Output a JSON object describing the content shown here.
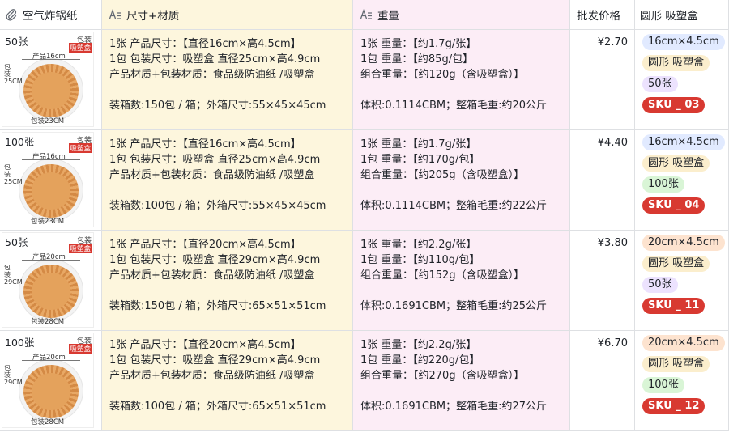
{
  "headers": {
    "col1": "空气炸锅纸",
    "col2": "尺寸+材质",
    "col3": "重量",
    "col4": "批发价格",
    "col5": "圆形 吸塑盒"
  },
  "rows": [
    {
      "image": {
        "qty": "50张",
        "pack": "包装",
        "pack_red": "吸塑盒",
        "size": "产品16cm",
        "vertical": "包装25CM",
        "bottom": "包装23CM"
      },
      "size_lines": [
        "1张 产品尺寸：【直径16cm×高4.5cm】",
        "1包 包装尺寸：吸塑盒 直径25cm×高4.9cm",
        "产品材质+包装材质：食品级防油纸 /吸塑盒",
        "装箱数:150包 / 箱；外箱尺寸:55×45×45cm"
      ],
      "weight_lines": [
        "1张 重量：【约1.7g/张】",
        "1包 重量：【约85g/包】",
        "组合重量：【约120g（含吸塑盒）】",
        "体积:0.1114CBM；整箱毛重:约20公斤"
      ],
      "price": "¥2.70",
      "tags": [
        "16cm×4.5cm",
        "圆形 吸塑盒",
        "50张",
        "SKU _ 03"
      ]
    },
    {
      "image": {
        "qty": "100张",
        "pack": "包装",
        "pack_red": "吸塑盒",
        "size": "产品16cm",
        "vertical": "包装25CM",
        "bottom": "包装23CM"
      },
      "size_lines": [
        "1张 产品尺寸：【直径16cm×高4.5cm】",
        "1包 包装尺寸：吸塑盒 直径25cm×高4.9cm",
        "产品材质+包装材质：食品级防油纸 /吸塑盒",
        "装箱数:100包 / 箱；外箱尺寸:55×45×45cm"
      ],
      "weight_lines": [
        "1张 重量：【约1.7g/张】",
        "1包 重量：【约170g/包】",
        "组合重量：【约205g（含吸塑盒）】",
        "体积:0.1114CBM；整箱毛重:约22公斤"
      ],
      "price": "¥4.40",
      "tags": [
        "16cm×4.5cm",
        "圆形 吸塑盒",
        "100张",
        "SKU _ 04"
      ]
    },
    {
      "image": {
        "qty": "50张",
        "pack": "包装",
        "pack_red": "吸塑盒",
        "size": "产品20cm",
        "vertical": "包装29CM",
        "bottom": "包装28CM"
      },
      "size_lines": [
        "1张 产品尺寸：【直径20cm×高4.5cm】",
        "1包 包装尺寸：吸塑盒 直径29cm×高4.9cm",
        "产品材质+包装材质：食品级防油纸 /吸塑盒",
        "装箱数:150包 / 箱；外箱尺寸:65×51×51cm"
      ],
      "weight_lines": [
        "1张 重量：【约2.2g/张】",
        "1包 重量：【约110g/包】",
        "组合重量：【约152g（含吸塑盒）】",
        "体积:0.1691CBM；整箱毛重:约25公斤"
      ],
      "price": "¥3.80",
      "tags": [
        "20cm×4.5cm",
        "圆形 吸塑盒",
        "50张",
        "SKU _ 11"
      ]
    },
    {
      "image": {
        "qty": "100张",
        "pack": "包装",
        "pack_red": "吸塑盒",
        "size": "产品20cm",
        "vertical": "包装29CM",
        "bottom": "包装28CM"
      },
      "size_lines": [
        "1张 产品尺寸：【直径20cm×高4.5cm】",
        "1包 包装尺寸：吸塑盒 直径29cm×高4.9cm",
        "产品材质+包装材质：食品级防油纸 /吸塑盒",
        "装箱数:100包 / 箱；外箱尺寸:65×51×51cm"
      ],
      "weight_lines": [
        "1张 重量：【约2.2g/张】",
        "1包 重量：【约220g/包】",
        "组合重量：【约270g（含吸塑盒）】",
        "体积:0.1691CBM；整箱毛重:约27公斤"
      ],
      "price": "¥6.70",
      "tags": [
        "20cm×4.5cm",
        "圆形 吸塑盒",
        "100张",
        "SKU _ 12"
      ]
    }
  ],
  "tag_colors": [
    "#e1eaff",
    "#fbeecd",
    "#ece2fe",
    "#d83931"
  ]
}
